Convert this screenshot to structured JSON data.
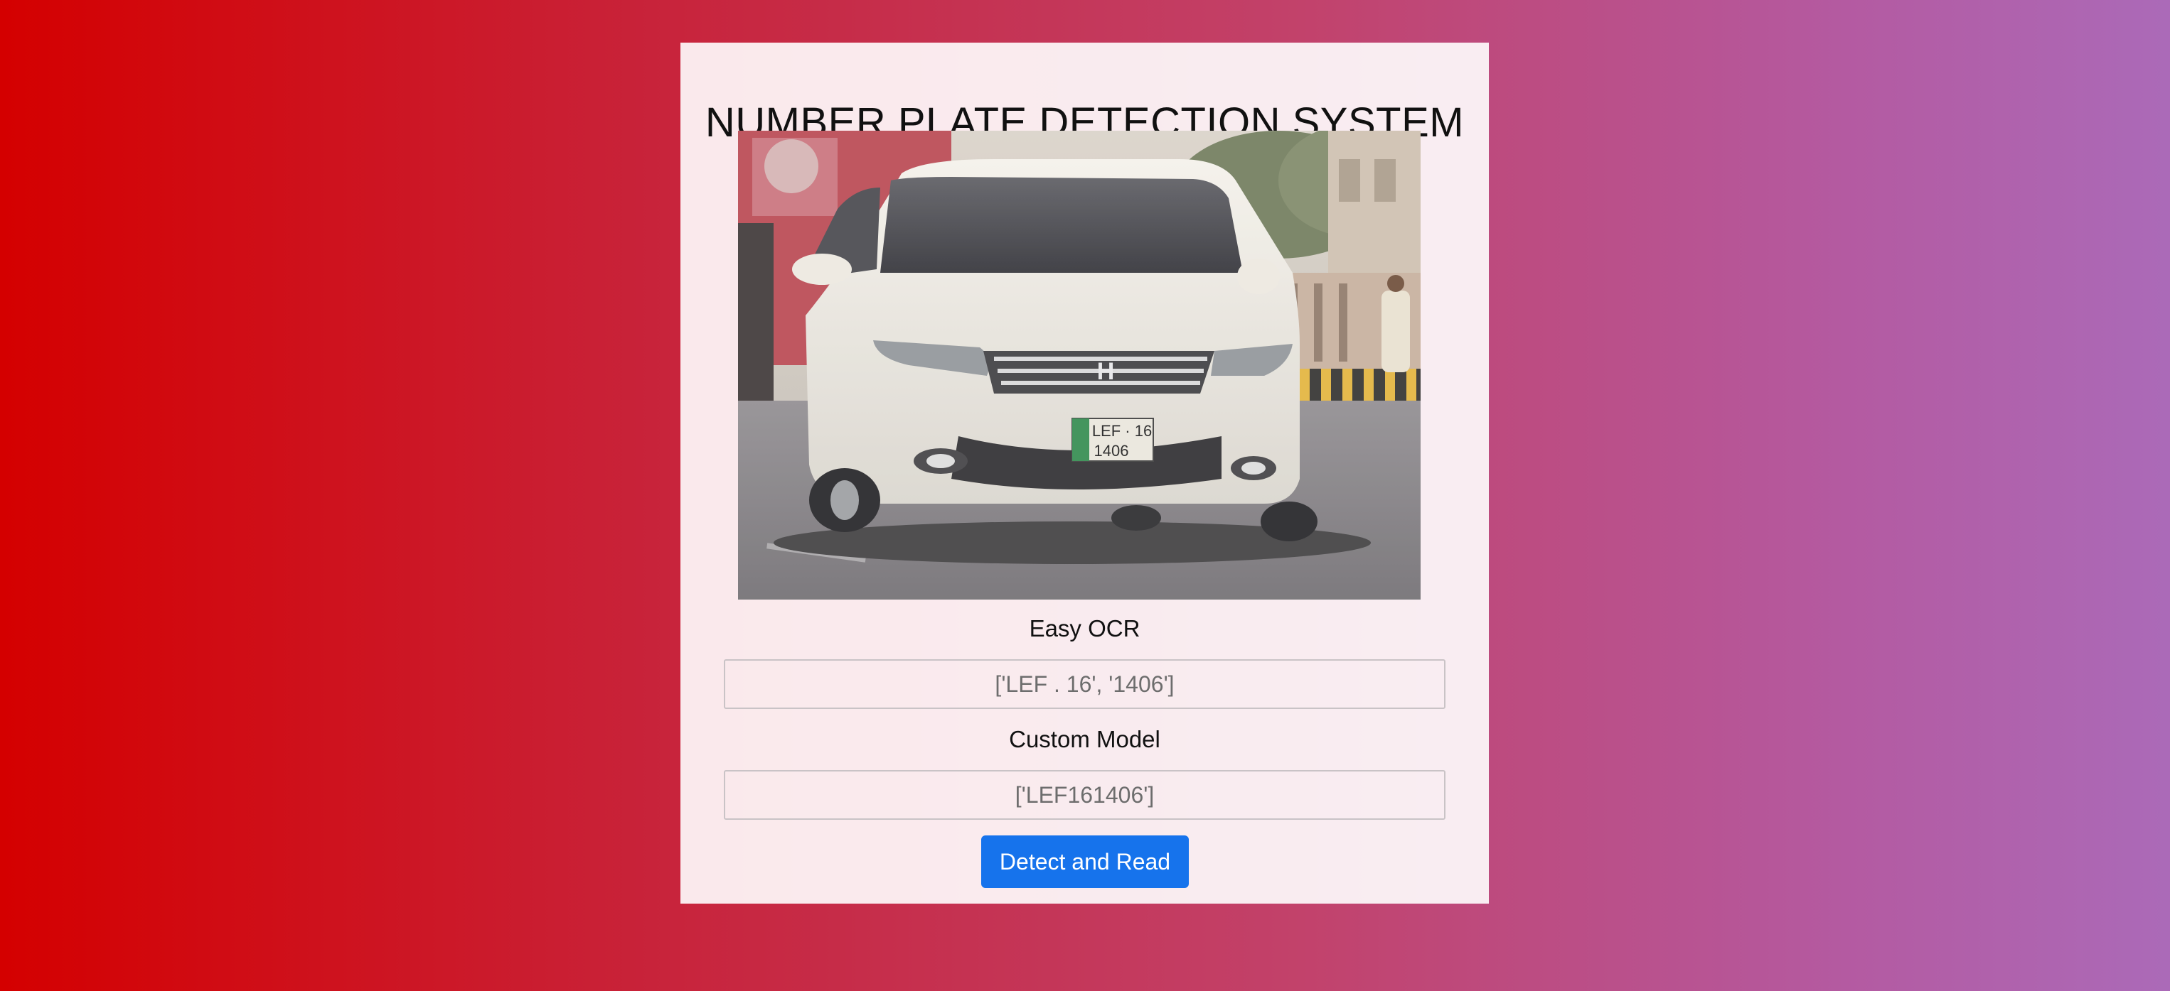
{
  "app": {
    "title": "NUMBER PLATE DETECTION SYSTEM"
  },
  "image": {
    "plate_text_line1": "LEF · 16",
    "plate_text_line2": "1406"
  },
  "easy_ocr": {
    "label": "Easy OCR",
    "value": "['LEF . 16', '1406']"
  },
  "custom_model": {
    "label": "Custom Model",
    "value": "['LEF161406']"
  },
  "actions": {
    "detect_label": "Detect and Read"
  },
  "colors": {
    "button_bg": "#1673ec",
    "card_bg": "#f8eef1",
    "gradient_start": "#d40000",
    "gradient_end": "#ab6ab8"
  }
}
